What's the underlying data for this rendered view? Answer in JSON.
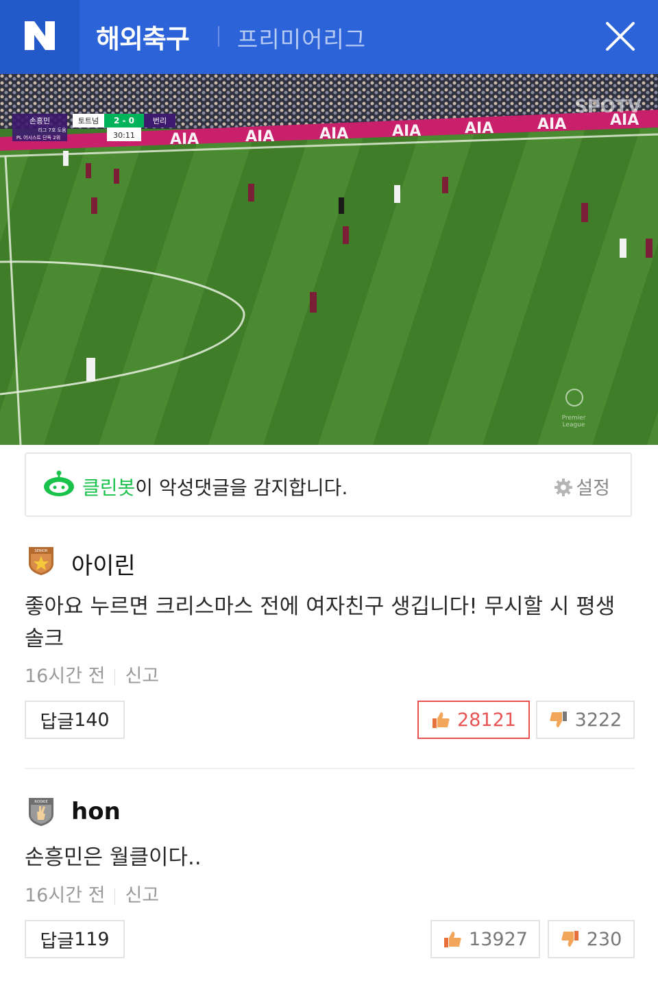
{
  "header": {
    "logo_letter": "N",
    "title": "해외축구",
    "subtitle": "프리미어리그",
    "brand_color": "#2d63d8"
  },
  "video": {
    "scoreboard": {
      "player": "손흥민",
      "player_note1": "리그 7호 도움",
      "player_note2": "PL 어시스트 단독 2위",
      "home": "토트넘",
      "score": "2 - 0",
      "away": "번리",
      "clock": "30:11"
    },
    "broadcaster": "SPOTV",
    "ad_text": "AIA",
    "league_mark_1": "Premier",
    "league_mark_2": "League"
  },
  "cleanbot": {
    "highlight": "클린봇",
    "text": "이 악성댓글을 감지합니다.",
    "settings_label": "설정",
    "accent_color": "#19c24a"
  },
  "comments": [
    {
      "badge_icon": "senior-star-badge-icon",
      "badge_text": "SENIOR",
      "username": "아이린",
      "text": "좋아요 누르면 크리스마스 전에 여자친구 생깁니다! 무시할 시 평생 솔크",
      "time": "16시간 전",
      "report": "신고",
      "reply_label": "답글",
      "reply_count": "140",
      "likes": "28121",
      "dislikes": "3222",
      "liked": true
    },
    {
      "badge_icon": "rookie-hand-badge-icon",
      "badge_text": "ROOKIE",
      "username": "hon",
      "text": "손흥민은 월클이다..",
      "time": "16시간 전",
      "report": "신고",
      "reply_label": "답글",
      "reply_count": "119",
      "likes": "13927",
      "dislikes": "230",
      "liked": false
    }
  ]
}
